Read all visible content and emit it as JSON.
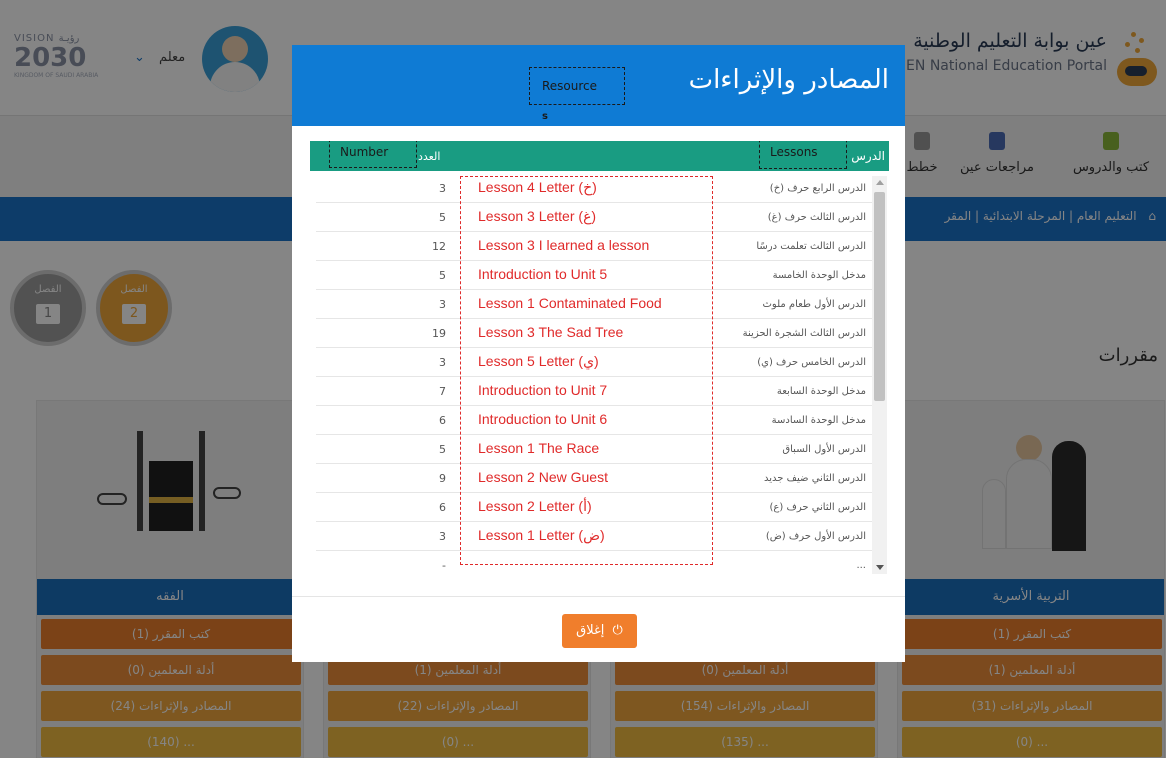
{
  "header": {
    "vision_top": "VISION ﺭﺅﻳـﺔ",
    "vision_year": "2030",
    "vision_sub": "KINGDOM OF SAUDI ARABIA",
    "user_role": "معلم",
    "chevron": "⌄",
    "portal_name_ar": "عين بوابة التعليم الوطنية",
    "portal_name_en": "iEN National Education Portal"
  },
  "nav": {
    "items": [
      {
        "label": "كتب والدروس",
        "icon": "book-icon",
        "color": "#8bb83a"
      },
      {
        "label": "مراجعات عين",
        "icon": "review-icon",
        "color": "#4b6cb7"
      },
      {
        "label": "خطط",
        "icon": "plan-icon",
        "color": "#9a9a9a"
      }
    ]
  },
  "breadcrumb": "التعليم العام | المرحلة الابتدائية | المقر",
  "semesters": {
    "s1": {
      "label": "الفصل",
      "num": "1",
      "color": "#9e9e9e"
    },
    "s2": {
      "label": "الفصل",
      "num": "2",
      "color": "#f0a83b"
    }
  },
  "courses_title": "مقررات",
  "cards": [
    {
      "title": "الفقه",
      "books": "كتب المقرر (1)",
      "guides": "أدلة المعلمين (0)",
      "resources": "المصادر والإثراءات (24)",
      "more": "(140) ..."
    },
    {
      "title": "",
      "books": "",
      "guides": "أدلة المعلمين (1)",
      "resources": "المصادر والإثراءات (22)",
      "more": "(0) ..."
    },
    {
      "title": "",
      "books": "",
      "guides": "أدلة المعلمين (0)",
      "resources": "المصادر والإثراءات (154)",
      "more": "(135) ..."
    },
    {
      "title": "التربية الأسرية",
      "books": "كتب المقرر (1)",
      "guides": "أدلة المعلمين (1)",
      "resources": "المصادر والإثراءات (31)",
      "more": "(0) ..."
    }
  ],
  "modal": {
    "title": "المصادر والإثراءات",
    "annotation_resources": "Resource",
    "annotation_resources_cont": "s",
    "col_lessons_ar": "الدرس",
    "col_count_ar": "العدد",
    "annotation_lessons": "Lessons",
    "annotation_number": "Number",
    "rows": [
      {
        "ar": "الدرس الرابع حرف (خ)",
        "en": "Lesson 4 Letter (خ)",
        "count": "3"
      },
      {
        "ar": "الدرس الثالث حرف (غ)",
        "en": "Lesson 3 Letter (غ)",
        "count": "5"
      },
      {
        "ar": "الدرس الثالث تعلمت درسًا",
        "en": "Lesson 3 I learned a lesson",
        "count": "12"
      },
      {
        "ar": "مدخل الوحدة الخامسة",
        "en": "Introduction to Unit 5",
        "count": "5"
      },
      {
        "ar": "الدرس الأول طعام ملوث",
        "en": "Lesson 1 Contaminated Food",
        "count": "3"
      },
      {
        "ar": "الدرس الثالث الشجرة الحزينة",
        "en": "Lesson 3 The Sad Tree",
        "count": "19"
      },
      {
        "ar": "الدرس الخامس حرف (ي)",
        "en": "Lesson 5 Letter (ي)",
        "count": "3"
      },
      {
        "ar": "مدخل الوحدة السابعة",
        "en": "Introduction to Unit 7",
        "count": "7"
      },
      {
        "ar": "مدخل الوحدة السادسة",
        "en": "Introduction to Unit 6",
        "count": "6"
      },
      {
        "ar": "الدرس الأول السباق",
        "en": "Lesson 1 The Race",
        "count": "5"
      },
      {
        "ar": "الدرس الثاني ضيف جديد",
        "en": "Lesson 2 New Guest",
        "count": "9"
      },
      {
        "ar": "الدرس الثاني حرف (ع)",
        "en": "Lesson 2 Letter (أ)",
        "count": "6"
      },
      {
        "ar": "الدرس الأول حرف (ض)",
        "en": "Lesson 1 Letter (ض)",
        "count": "3"
      },
      {
        "ar": "...",
        "en": "",
        "count": "-"
      }
    ],
    "close_label": "إغلاق",
    "close_icon": "power-icon"
  }
}
